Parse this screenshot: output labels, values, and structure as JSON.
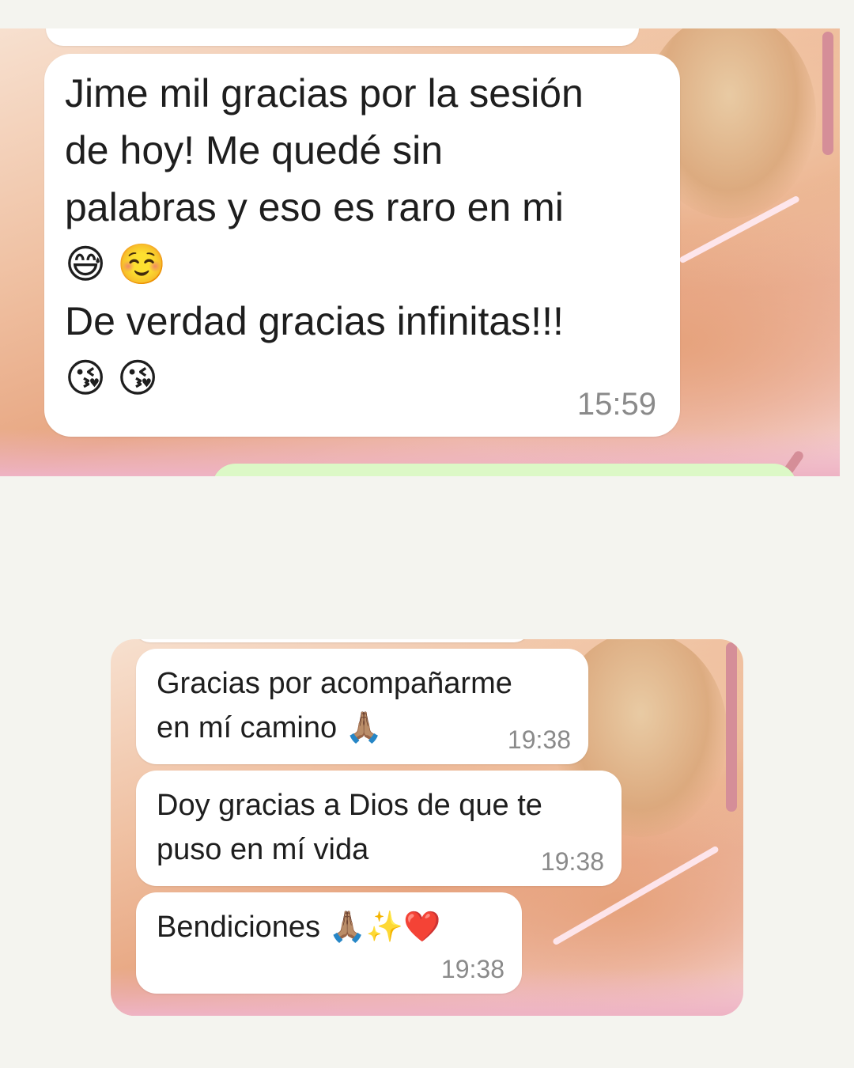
{
  "top_chat": {
    "message": {
      "text": "Jime mil gracias por la sesión\nde hoy! Me quedé sin\npalabras y eso es raro en mi\n😅 ☺️\nDe verdad gracias infinitas!!!\n😘 😘",
      "time": "15:59"
    }
  },
  "bottom_chat": {
    "messages": [
      {
        "text": "Gracias por acompañarme\nen mí camino 🙏🏽",
        "time": "19:38"
      },
      {
        "text": "Doy gracias a Dios de que te\npuso en mí vida",
        "time": "19:38"
      },
      {
        "text": "Bendiciones 🙏🏽✨❤️",
        "time": "19:38"
      }
    ]
  },
  "colors": {
    "page_background": "#f4f4ef",
    "incoming_bubble": "#ffffff",
    "outgoing_bubble": "#dcf8c6",
    "timestamp": "#8a8a8a",
    "scrollbar": "#d58e98"
  }
}
